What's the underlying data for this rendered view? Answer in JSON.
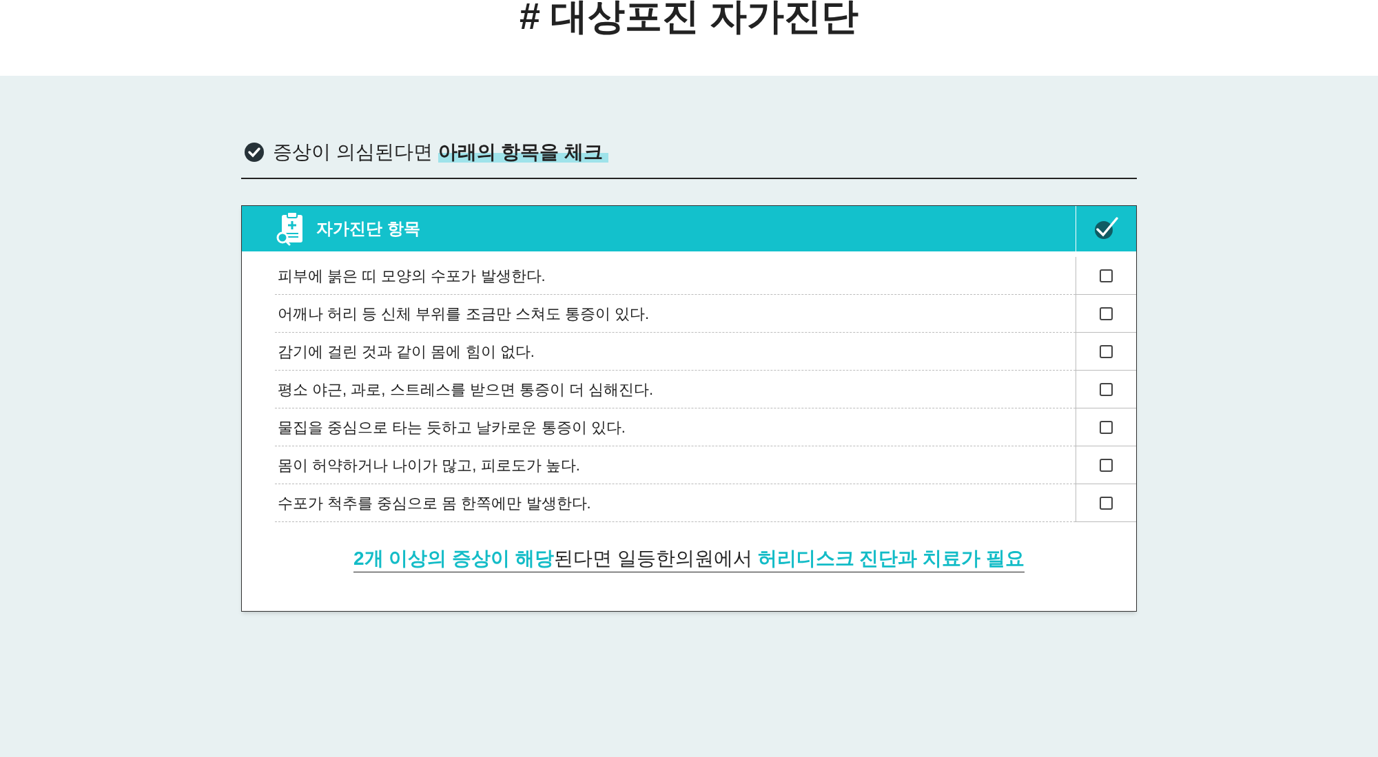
{
  "page_title": "# 대상포진 자가진단",
  "section_heading": {
    "segments": [
      {
        "text": "증상이 의심된다면 ",
        "highlight": false
      },
      {
        "text": "아래의 항목을 체크",
        "highlight": true
      }
    ]
  },
  "table": {
    "header_label": "자가진단 항목",
    "rows": [
      {
        "text": "피부에 붉은 띠 모양의 수포가 발생한다.",
        "checked": false
      },
      {
        "text": "어깨나 허리 등 신체 부위를 조금만 스쳐도 통증이 있다.",
        "checked": false
      },
      {
        "text": "감기에 걸린 것과 같이 몸에 힘이 없다.",
        "checked": false
      },
      {
        "text": "평소 야근, 과로, 스트레스를 받으면 통증이 더 심해진다.",
        "checked": false
      },
      {
        "text": "물집을 중심으로 타는 듯하고 날카로운 통증이 있다.",
        "checked": false
      },
      {
        "text": "몸이 허약하거나 나이가 많고, 피로도가 높다.",
        "checked": false
      },
      {
        "text": "수포가 척추를 중심으로 몸 한쪽에만 발생한다.",
        "checked": false
      }
    ]
  },
  "conclusion": {
    "segments": [
      {
        "text": "2개 이상의 증상이 해당",
        "highlight": true
      },
      {
        "text": "된다면 일등한의원에서 ",
        "highlight": false
      },
      {
        "text": "허리디스크 진단과 치료가 필요",
        "highlight": true
      }
    ]
  }
}
